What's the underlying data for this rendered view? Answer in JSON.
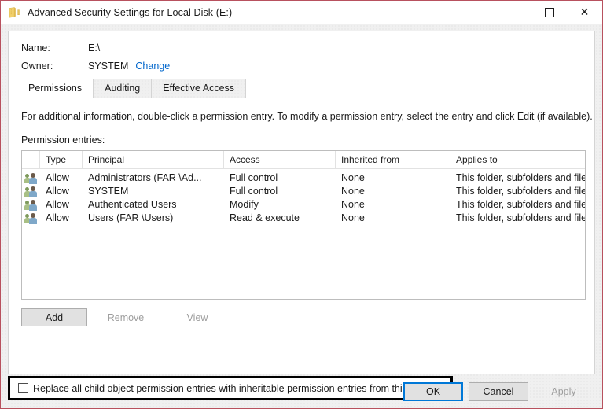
{
  "window": {
    "title": "Advanced Security Settings for Local Disk (E:)",
    "icon": "folder-drive-icon",
    "border_color": "#b8515e",
    "controls": {
      "minimize": "minimize-icon",
      "maximize": "maximize-icon",
      "close": "close-icon"
    }
  },
  "header": {
    "name_label": "Name:",
    "name_value": "E:\\",
    "owner_label": "Owner:",
    "owner_value": "SYSTEM",
    "owner_change_link": "Change",
    "link_color": "#0066cc"
  },
  "tabs": [
    {
      "label": "Permissions",
      "active": true
    },
    {
      "label": "Auditing",
      "active": false
    },
    {
      "label": "Effective Access",
      "active": false
    }
  ],
  "main": {
    "info_text": "For additional information, double-click a permission entry. To modify a permission entry, select the entry and click Edit (if available).",
    "entries_label": "Permission entries:"
  },
  "table": {
    "columns": [
      "",
      "Type",
      "Principal",
      "Access",
      "Inherited from",
      "Applies to"
    ],
    "rows": [
      {
        "icon": "group-users-icon",
        "type": "Allow",
        "principal": "Administrators (FAR \\Ad...",
        "access": "Full control",
        "inherited_from": "None",
        "applies_to": "This folder, subfolders and files"
      },
      {
        "icon": "group-users-icon",
        "type": "Allow",
        "principal": "SYSTEM",
        "access": "Full control",
        "inherited_from": "None",
        "applies_to": "This folder, subfolders and files"
      },
      {
        "icon": "group-users-icon",
        "type": "Allow",
        "principal": "Authenticated Users",
        "access": "Modify",
        "inherited_from": "None",
        "applies_to": "This folder, subfolders and files"
      },
      {
        "icon": "group-users-icon",
        "type": "Allow",
        "principal": "Users (FAR \\Users)",
        "access": "Read & execute",
        "inherited_from": "None",
        "applies_to": "This folder, subfolders and files"
      }
    ]
  },
  "actions": {
    "add": {
      "label": "Add",
      "enabled": true
    },
    "remove": {
      "label": "Remove",
      "enabled": false
    },
    "view": {
      "label": "View",
      "enabled": false
    }
  },
  "replace_option": {
    "label": "Replace all child object permission entries with inheritable permission entries from this object",
    "checked": false,
    "highlight_color": "#000000"
  },
  "footer": {
    "ok": {
      "label": "OK",
      "enabled": true,
      "focused": true
    },
    "cancel": {
      "label": "Cancel",
      "enabled": true
    },
    "apply": {
      "label": "Apply",
      "enabled": false
    },
    "focus_color": "#0078d7"
  }
}
